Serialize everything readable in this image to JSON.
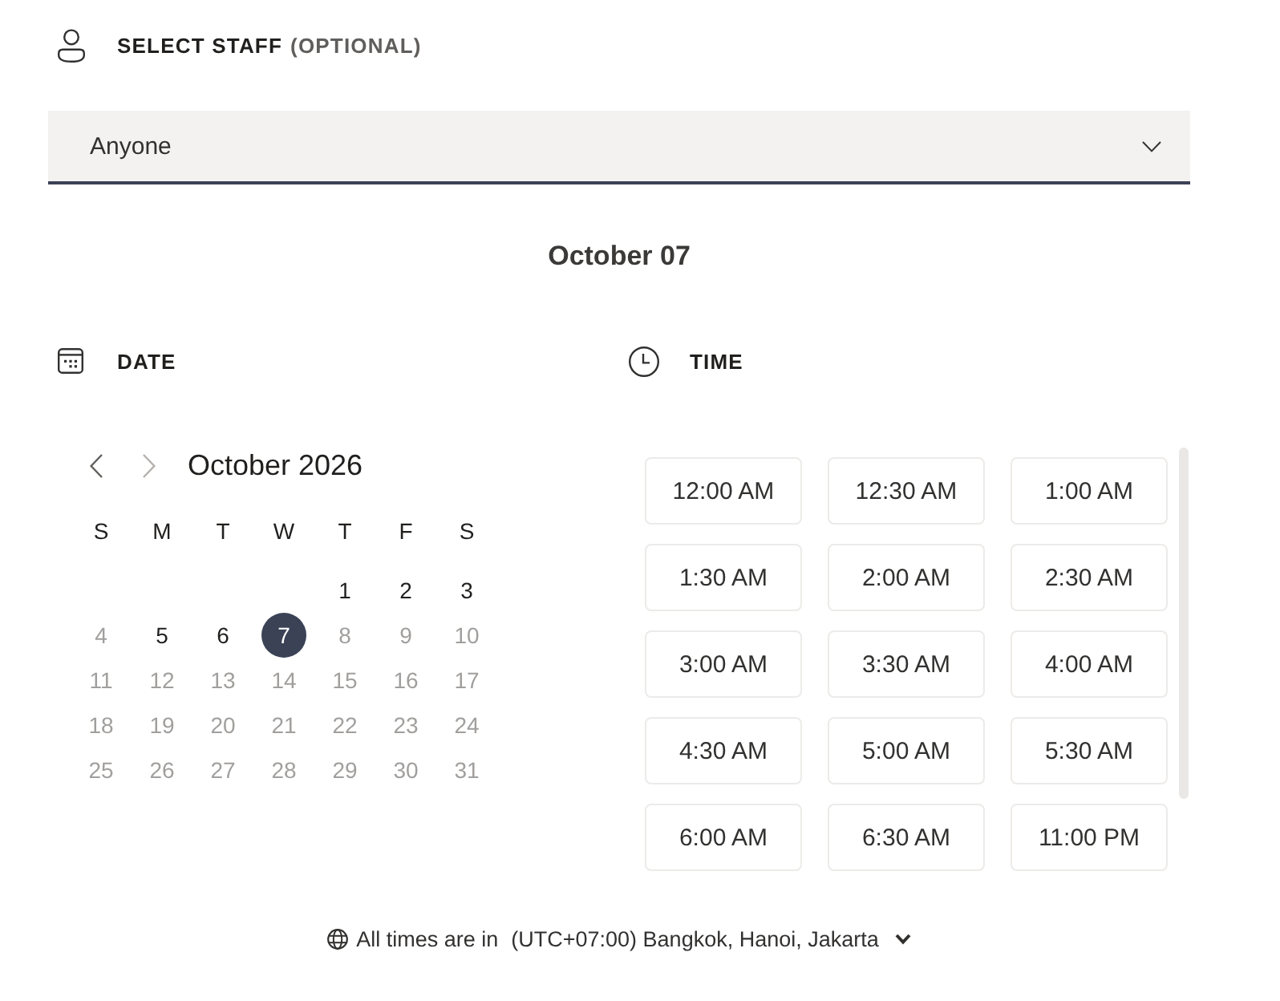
{
  "staff": {
    "title": "SELECT STAFF",
    "note": "(OPTIONAL)",
    "dropdown": {
      "value": "Anyone"
    }
  },
  "selected_date": "October 07",
  "date": {
    "title": "DATE",
    "calendar": {
      "month": "October 2026",
      "previous": {
        "disabled": false
      },
      "next": {
        "disabled": true
      },
      "weekdays": [
        "S",
        "M",
        "T",
        "W",
        "T",
        "F",
        "S"
      ],
      "weeks": [
        {
          "days": [
            {
              "kind": "blank"
            },
            {
              "kind": "blank"
            },
            {
              "kind": "blank"
            },
            {
              "kind": "blank"
            },
            {
              "kind": "day",
              "label": "1",
              "available": true,
              "selected": false
            },
            {
              "kind": "day",
              "label": "2",
              "available": true,
              "selected": false
            },
            {
              "kind": "day",
              "label": "3",
              "available": true,
              "selected": false
            }
          ]
        },
        {
          "days": [
            {
              "kind": "day",
              "label": "4",
              "available": false,
              "selected": false
            },
            {
              "kind": "day",
              "label": "5",
              "available": true,
              "selected": false
            },
            {
              "kind": "day",
              "label": "6",
              "available": true,
              "selected": false
            },
            {
              "kind": "day",
              "label": "7",
              "available": true,
              "selected": true
            },
            {
              "kind": "day",
              "label": "8",
              "available": false,
              "selected": false
            },
            {
              "kind": "day",
              "label": "9",
              "available": false,
              "selected": false
            },
            {
              "kind": "day",
              "label": "10",
              "available": false,
              "selected": false
            }
          ]
        },
        {
          "days": [
            {
              "kind": "day",
              "label": "11",
              "available": false,
              "selected": false
            },
            {
              "kind": "day",
              "label": "12",
              "available": false,
              "selected": false
            },
            {
              "kind": "day",
              "label": "13",
              "available": false,
              "selected": false
            },
            {
              "kind": "day",
              "label": "14",
              "available": false,
              "selected": false
            },
            {
              "kind": "day",
              "label": "15",
              "available": false,
              "selected": false
            },
            {
              "kind": "day",
              "label": "16",
              "available": false,
              "selected": false
            },
            {
              "kind": "day",
              "label": "17",
              "available": false,
              "selected": false
            }
          ]
        },
        {
          "days": [
            {
              "kind": "day",
              "label": "18",
              "available": false,
              "selected": false
            },
            {
              "kind": "day",
              "label": "19",
              "available": false,
              "selected": false
            },
            {
              "kind": "day",
              "label": "20",
              "available": false,
              "selected": false
            },
            {
              "kind": "day",
              "label": "21",
              "available": false,
              "selected": false
            },
            {
              "kind": "day",
              "label": "22",
              "available": false,
              "selected": false
            },
            {
              "kind": "day",
              "label": "23",
              "available": false,
              "selected": false
            },
            {
              "kind": "day",
              "label": "24",
              "available": false,
              "selected": false
            }
          ]
        },
        {
          "days": [
            {
              "kind": "day",
              "label": "25",
              "available": false,
              "selected": false
            },
            {
              "kind": "day",
              "label": "26",
              "available": false,
              "selected": false
            },
            {
              "kind": "day",
              "label": "27",
              "available": false,
              "selected": false
            },
            {
              "kind": "day",
              "label": "28",
              "available": false,
              "selected": false
            },
            {
              "kind": "day",
              "label": "29",
              "available": false,
              "selected": false
            },
            {
              "kind": "day",
              "label": "30",
              "available": false,
              "selected": false
            },
            {
              "kind": "day",
              "label": "31",
              "available": false,
              "selected": false
            }
          ]
        }
      ]
    }
  },
  "time": {
    "title": "TIME",
    "slots": [
      {
        "label": "12:00 AM",
        "selected": false
      },
      {
        "label": "12:30 AM",
        "selected": false
      },
      {
        "label": "1:00 AM",
        "selected": false
      },
      {
        "label": "1:30 AM",
        "selected": false
      },
      {
        "label": "2:00 AM",
        "selected": false
      },
      {
        "label": "2:30 AM",
        "selected": false
      },
      {
        "label": "3:00 AM",
        "selected": false
      },
      {
        "label": "3:30 AM",
        "selected": false
      },
      {
        "label": "4:00 AM",
        "selected": false
      },
      {
        "label": "4:30 AM",
        "selected": false
      },
      {
        "label": "5:00 AM",
        "selected": false
      },
      {
        "label": "5:30 AM",
        "selected": false
      },
      {
        "label": "6:00 AM",
        "selected": false
      },
      {
        "label": "6:30 AM",
        "selected": false
      },
      {
        "label": "11:00 PM",
        "selected": false
      }
    ]
  },
  "timezone": {
    "label": "All times are in",
    "value": "(UTC+07:00) Bangkok, Hanoi, Jakarta"
  }
}
